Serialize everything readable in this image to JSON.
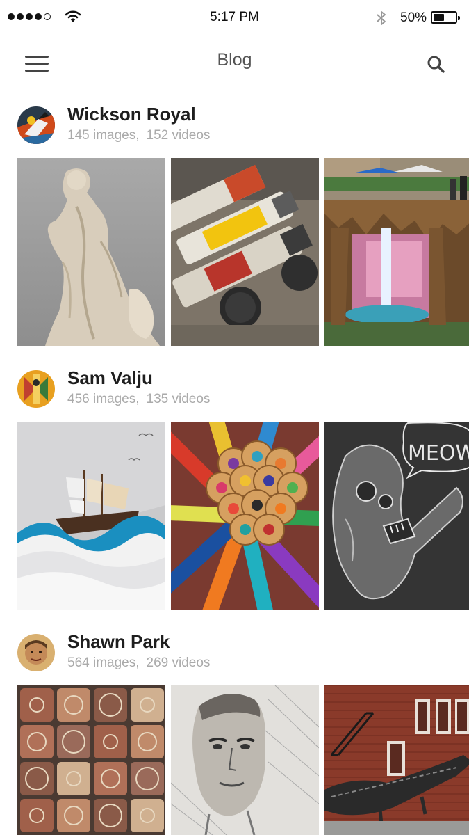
{
  "status_bar": {
    "time": "5:17 PM",
    "battery_percent": "50%",
    "battery_level": 0.5,
    "signal_strength": 4,
    "icons": [
      "signal-dots",
      "wifi-icon",
      "bluetooth-icon",
      "battery-icon"
    ]
  },
  "nav": {
    "title": "Blog",
    "left_icon": "menu-icon",
    "right_icon": "search-icon"
  },
  "authors": [
    {
      "name": "Wickson Royal",
      "images": "145 images,",
      "videos": "152 videos",
      "photos": [
        "marble-statue",
        "paint-tubes",
        "street-waterfall-art"
      ]
    },
    {
      "name": "Sam Valju",
      "images": "456 images,",
      "videos": "135 videos",
      "photos": [
        "paper-ship-waves",
        "colored-pencils",
        "chalk-skull-meow"
      ]
    },
    {
      "name": "Shawn Park",
      "images": "564 images,",
      "videos": "269 videos",
      "photos": [
        "ceramic-tiles",
        "newspaper-face-collage",
        "brick-wall-crocodile-mural"
      ]
    }
  ],
  "artwork_text": {
    "chalk_bubble": "MEOW."
  },
  "colors": {
    "text_dark": "#1e1e1e",
    "text_muted": "#aaaaaa",
    "nav_title": "#555555"
  }
}
